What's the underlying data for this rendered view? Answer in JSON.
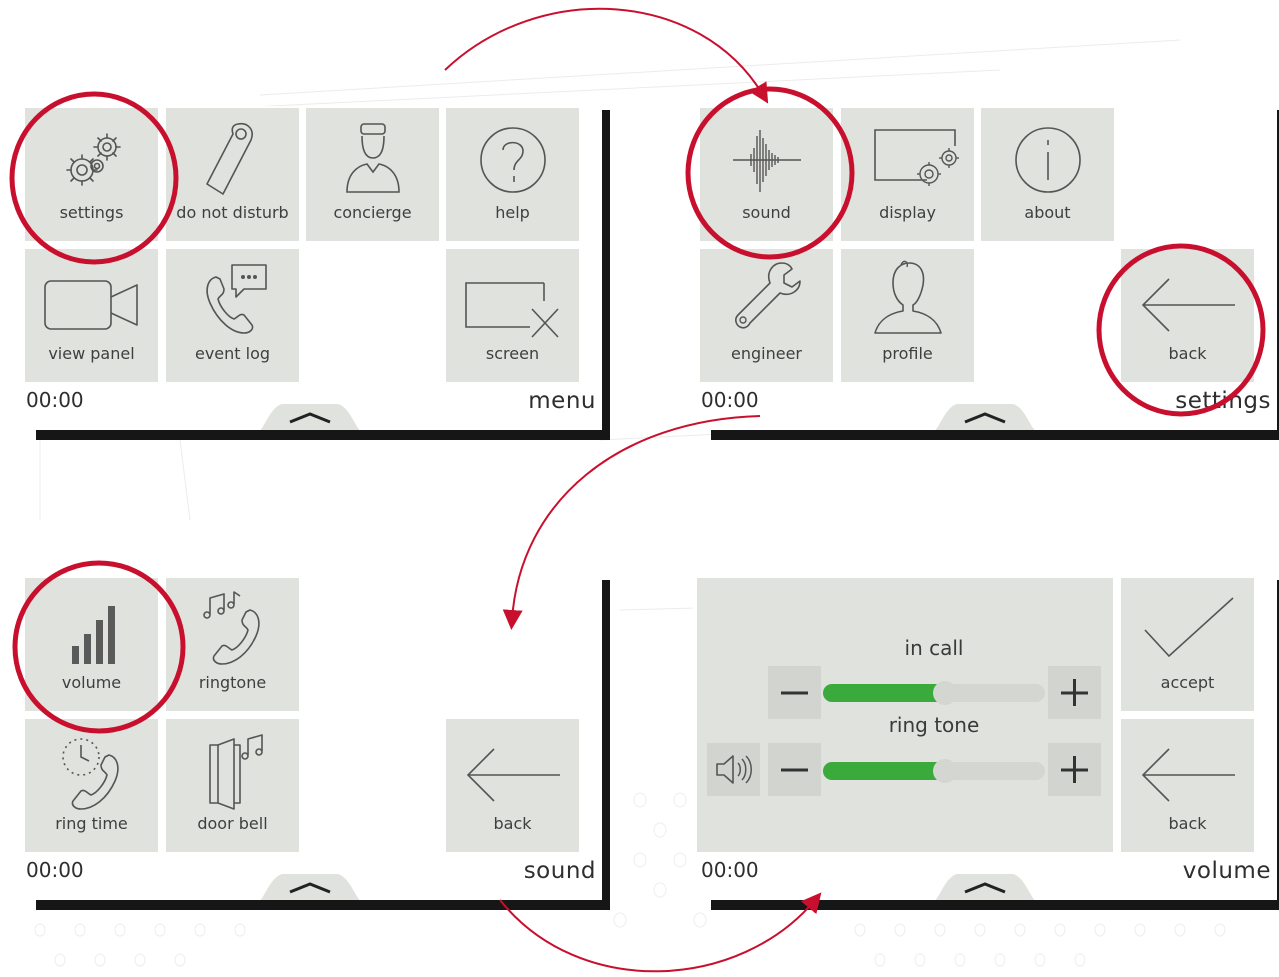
{
  "screens": {
    "menu": {
      "clock": "00:00",
      "title": "menu",
      "tiles": {
        "settings": "settings",
        "do_not_disturb": "do not disturb",
        "concierge": "concierge",
        "help": "help",
        "view_panel": "view panel",
        "event_log": "event log",
        "screen": "screen"
      }
    },
    "settings": {
      "clock": "00:00",
      "title": "settings",
      "tiles": {
        "sound": "sound",
        "display": "display",
        "about": "about",
        "engineer": "engineer",
        "profile": "profile",
        "back": "back"
      }
    },
    "sound": {
      "clock": "00:00",
      "title": "sound",
      "tiles": {
        "volume": "volume",
        "ringtone": "ringtone",
        "ring_time": "ring time",
        "door_bell": "door bell",
        "back": "back"
      }
    },
    "volume": {
      "clock": "00:00",
      "title": "volume",
      "in_call": {
        "label": "in call",
        "level": 0.55
      },
      "ring_tone": {
        "label": "ring tone",
        "level": 0.55
      },
      "accept": "accept",
      "back": "back"
    }
  },
  "icons": {
    "settings": "gears-icon",
    "do_not_disturb": "door-hanger-icon",
    "concierge": "concierge-person-icon",
    "help": "question-mark-icon",
    "view_panel": "video-camera-icon",
    "event_log": "phone-chat-icon",
    "screen": "screen-off-icon",
    "sound": "sound-wave-icon",
    "display": "display-settings-icon",
    "about": "info-icon",
    "engineer": "wrench-icon",
    "profile": "profile-silhouette-icon",
    "back": "arrow-left-icon",
    "volume": "volume-bars-icon",
    "ringtone": "phone-music-icon",
    "ring_time": "phone-clock-icon",
    "door_bell": "door-music-icon",
    "accept": "checkmark-icon",
    "speaker": "speaker-icon"
  },
  "colors": {
    "tile": "#dfe2dd",
    "highlight_ring": "#c8102e",
    "slider_fill": "#3aaa3c",
    "shadow": "#161616"
  }
}
